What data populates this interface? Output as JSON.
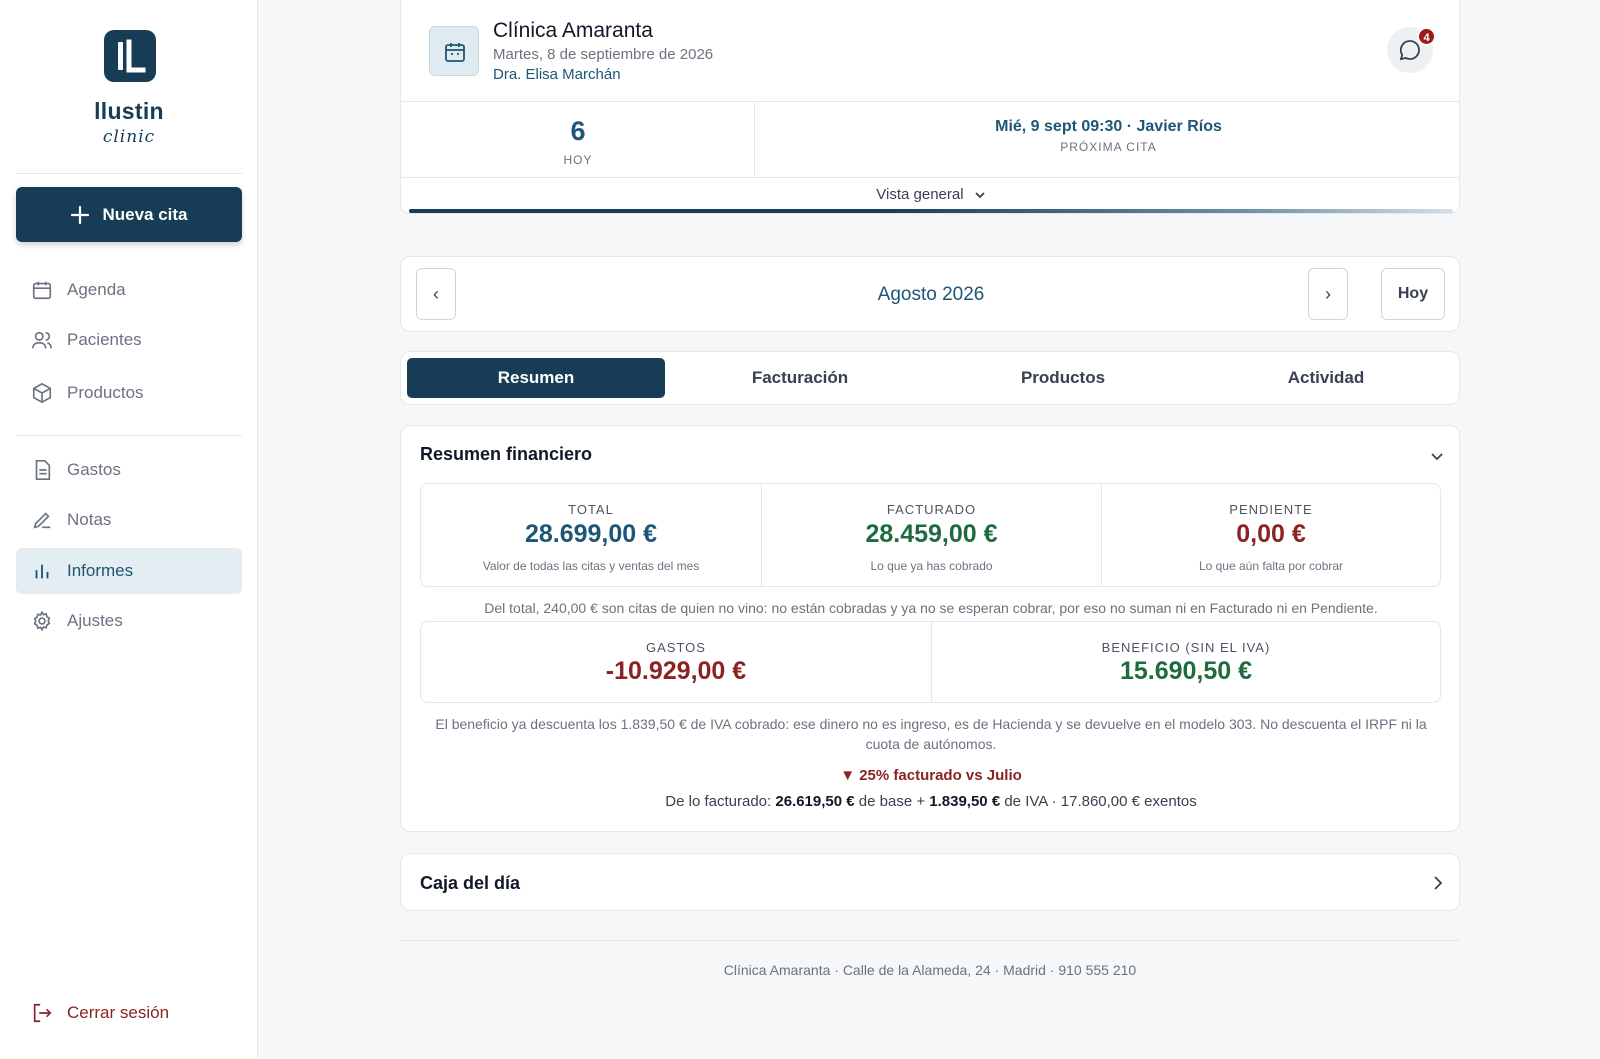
{
  "sidebar": {
    "brand": "llustin",
    "brand_sub": "clinic",
    "new_appointment": "Nueva cita",
    "nav": [
      {
        "label": "Agenda",
        "icon": "calendar-icon"
      },
      {
        "label": "Pacientes",
        "icon": "users-icon"
      },
      {
        "label": "Productos",
        "icon": "box-icon"
      },
      {
        "label": "Gastos",
        "icon": "document-icon"
      },
      {
        "label": "Notas",
        "icon": "pencil-icon"
      },
      {
        "label": "Informes",
        "icon": "bar-chart-icon",
        "active": true
      },
      {
        "label": "Ajustes",
        "icon": "gear-icon"
      }
    ],
    "logout": "Cerrar sesión"
  },
  "header": {
    "clinic_name": "Clínica Amaranta",
    "date": "Martes, 8 de septiembre de 2026",
    "doctor": "Dra. Elisa Marchán",
    "messages_badge": "4",
    "today_count": "6",
    "today_label": "HOY",
    "next_appointment": "Mié, 9 sept 09:30 · Javier Ríos",
    "next_label": "PRÓXIMA CITA",
    "view_selector": "Vista general"
  },
  "month_nav": {
    "prev": "‹",
    "title": "Agosto 2026",
    "next": "›",
    "today": "Hoy"
  },
  "tabs": [
    {
      "label": "Resumen",
      "active": true
    },
    {
      "label": "Facturación"
    },
    {
      "label": "Productos"
    },
    {
      "label": "Actividad"
    }
  ],
  "financial": {
    "title": "Resumen financiero",
    "total": {
      "label": "TOTAL",
      "value": "28.699,00 €",
      "sub": "Valor de todas las citas y ventas del mes"
    },
    "invoiced": {
      "label": "FACTURADO",
      "value": "28.459,00 €",
      "sub": "Lo que ya has cobrado"
    },
    "pending": {
      "label": "PENDIENTE",
      "value": "0,00 €",
      "sub": "Lo que aún falta por cobrar"
    },
    "no_show_note": "Del total, 240,00 € son citas de quien no vino: no están cobradas y ya no se esperan cobrar, por eso no suman ni en Facturado ni en Pendiente.",
    "expenses": {
      "label": "GASTOS",
      "value": "-10.929,00 €"
    },
    "profit": {
      "label": "BENEFICIO (SIN EL IVA)",
      "value": "15.690,50 €"
    },
    "vat_note": "El beneficio ya descuenta los 1.839,50 € de IVA cobrado: ese dinero no es ingreso, es de Hacienda y se devuelve en el modelo 303. No descuenta el IRPF ni la cuota de autónomos.",
    "trend": "▼ 25% facturado vs Julio",
    "breakdown": {
      "prefix": "De lo facturado: ",
      "base": "26.619,50 €",
      "base_text": " de base + ",
      "vat": "1.839,50 €",
      "vat_text": " de IVA · 17.860,00 € exentos"
    }
  },
  "cash_box": {
    "title": "Caja del día"
  },
  "footer": "Clínica Amaranta · Calle de la Alameda, 24 · Madrid · 910 555 210",
  "colors": {
    "primary": "#173c55",
    "accent": "#1d5676",
    "positive": "#1f6b3f",
    "negative": "#8b2323"
  }
}
